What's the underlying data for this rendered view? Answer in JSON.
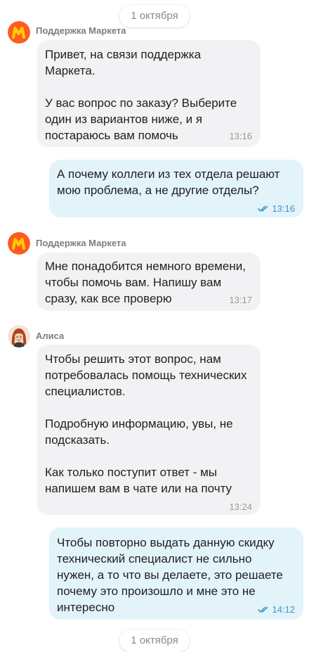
{
  "date_top": "1 октября",
  "date_bottom": "1 октября",
  "messages": [
    {
      "sender": "Поддержка Маркета",
      "text": "Привет, на связи поддержка\nМаркета.\n\nУ вас вопрос по заказу? Выберите\nодин из вариантов ниже, и я\nпостараюсь вам помочь",
      "time": "13:16"
    },
    {
      "text": "А почему коллеги из тех отдела решают\nмою проблема, а не другие отделы?",
      "time": "13:16"
    },
    {
      "sender": "Поддержка Маркета",
      "text": "Мне понадобится немного времени,\nчтобы помочь вам. Напишу вам\nсразу, как все проверю",
      "time": "13:17"
    },
    {
      "sender": "Алиса",
      "text": "Чтобы решить этот вопрос, нам\nпотребовалась помощь технических\nспециалистов.\n\nПодробную информацию, увы, не\nподсказать.\n\nКак только поступит ответ - мы\nнапишем вам в чате или на почту",
      "time": "13:24"
    },
    {
      "text": "Чтобы повторно выдать данную скидку\nтехнический специалист не сильно\nнужен, а то что вы делаете, это решаете\nпочему это произошло и мне это не\nинтересно",
      "time": "14:12"
    }
  ],
  "colors": {
    "incoming_bubble": "#f2f2f4",
    "outgoing_bubble": "#e3f3fa",
    "read_check": "#3c97c5",
    "market_logo_bg": "#ff5a1f",
    "market_logo_fg": "#ffcc00"
  },
  "icons": {
    "market_avatar": "yandex-market-logo",
    "alisa_avatar": "operator-photo",
    "read_status": "double-check"
  }
}
